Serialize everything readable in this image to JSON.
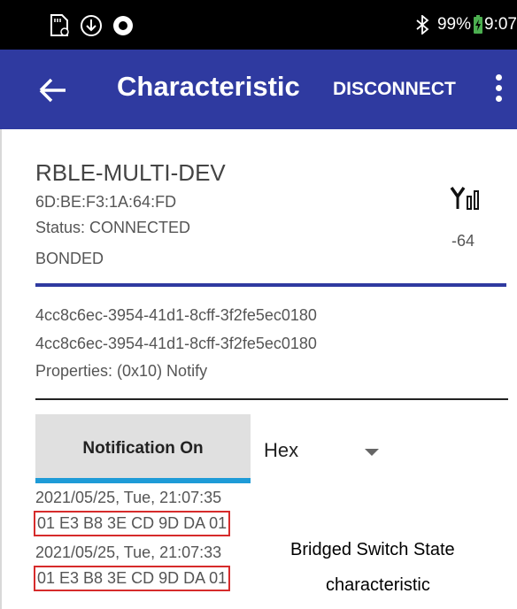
{
  "status_bar": {
    "battery": "99%",
    "time": "9:07",
    "icons": [
      "sd-card-icon",
      "download-icon",
      "record-icon",
      "bluetooth-icon",
      "battery-icon"
    ]
  },
  "app_bar": {
    "title": "Characteristic",
    "disconnect_label": "DISCONNECT",
    "icons": [
      "back-arrow-icon",
      "overflow-menu-icon"
    ],
    "color": "#2f3aa0"
  },
  "device": {
    "name": "RBLE-MULTI-DEV",
    "mac": "6D:BE:F3:1A:64:FD",
    "status": "Status:  CONNECTED",
    "bond": "BONDED",
    "rssi": "-64"
  },
  "characteristic": {
    "uuid_1": "4cc8c6ec-3954-41d1-8cff-3f2fe5ec0180",
    "uuid_2": "4cc8c6ec-3954-41d1-8cff-3f2fe5ec0180",
    "properties": "Properties: (0x10) Notify"
  },
  "controls": {
    "notification_button": "Notification On",
    "format_select": "Hex",
    "accent": "#1e9bd7"
  },
  "log": [
    {
      "timestamp": "2021/05/25, Tue, 21:07:35",
      "value": "01 E3 B8 3E CD 9D DA 01"
    },
    {
      "timestamp": "2021/05/25, Tue, 21:07:33",
      "value": "01 E3 B8 3E CD 9D DA 01"
    }
  ],
  "annotation": {
    "line_1": "Bridged Switch State",
    "line_2": "characteristic",
    "highlight_color": "#d62b2b"
  }
}
